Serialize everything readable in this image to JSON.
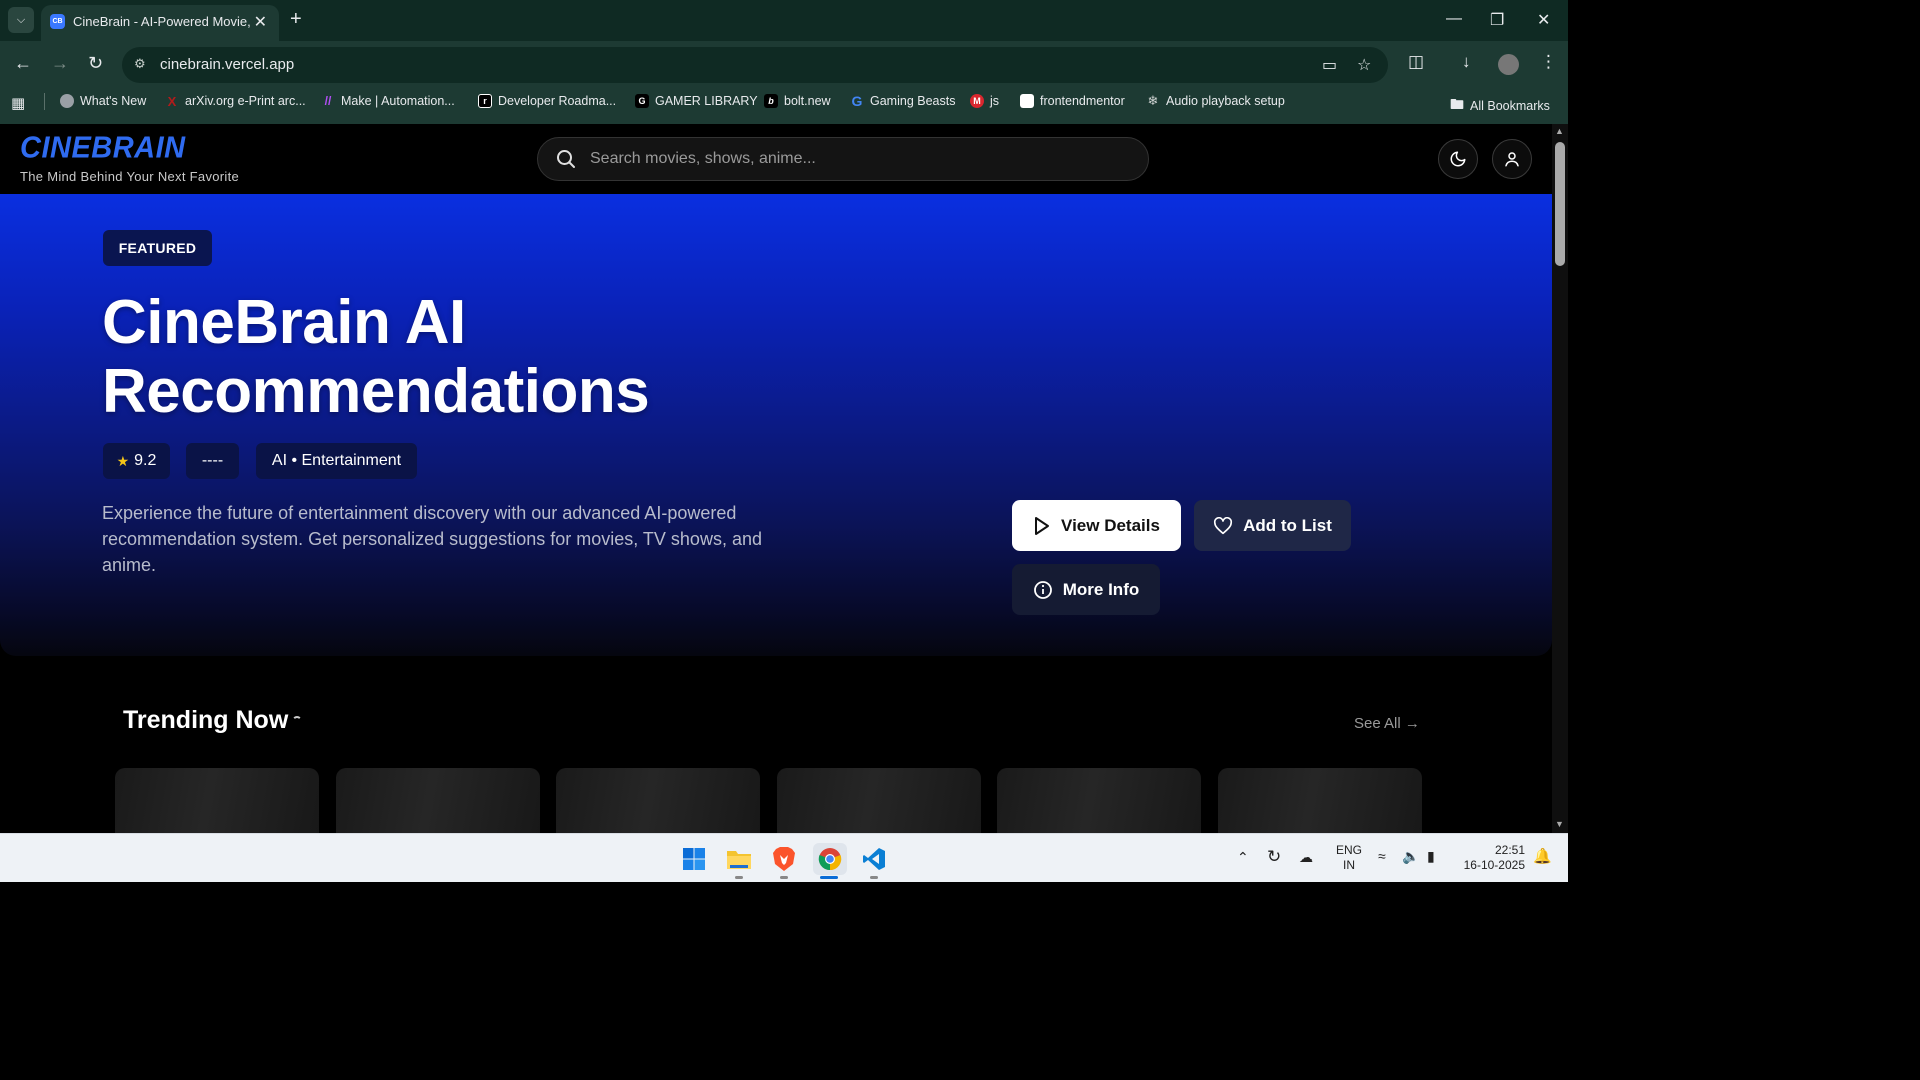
{
  "browser": {
    "tab_title": "CineBrain - AI-Powered Movie,",
    "tab_favicon": "CB",
    "url": "cinebrain.vercel.app",
    "bookmarks": [
      {
        "label": "What's New",
        "icon": "chrome-icon",
        "color": "#9aa0a6"
      },
      {
        "label": "arXiv.org e-Print arc...",
        "icon": "arxiv-icon",
        "color": "#b31b1b"
      },
      {
        "label": "Make | Automation...",
        "icon": "make-icon",
        "color": "#8b2cf5"
      },
      {
        "label": "Developer Roadma...",
        "icon": "roadmap-icon",
        "color": "#000000"
      },
      {
        "label": "GAMER LIBRARY",
        "icon": "gamer-library-icon",
        "color": "#000000"
      },
      {
        "label": "bolt.new",
        "icon": "bolt-icon",
        "color": "#000000"
      },
      {
        "label": "Gaming Beasts",
        "icon": "google-icon",
        "color": "#4285f4"
      },
      {
        "label": "js",
        "icon": "mega-icon",
        "color": "#d9272e"
      },
      {
        "label": "frontendmentor",
        "icon": "frontendmentor-icon",
        "color": "#ffffff"
      },
      {
        "label": "Audio playback setup",
        "icon": "openai-icon",
        "color": "#9aa0a6"
      }
    ],
    "all_bookmarks": "All Bookmarks"
  },
  "site": {
    "logo": "CINEBRAIN",
    "tagline": "The Mind Behind Your Next Favorite",
    "search_placeholder": "Search movies, shows, anime...",
    "accent": "#2f6bf0"
  },
  "hero": {
    "badge": "FEATURED",
    "title_line1": "CineBrain AI",
    "title_line2": "Recommendations",
    "rating": "9.2",
    "year": "----",
    "genre": "AI • Entertainment",
    "description": "Experience the future of entertainment discovery with our advanced AI-powered recommendation system. Get personalized suggestions for movies, TV shows, and anime.",
    "btn_view": "View Details",
    "btn_add": "Add to List",
    "btn_more": "More Info"
  },
  "trending": {
    "title": "Trending Now",
    "see_all": "See All →",
    "card_count_visible": 6
  },
  "taskbar": {
    "lang": "ENG",
    "region": "IN",
    "time": "22:51",
    "date": "16-10-2025"
  }
}
